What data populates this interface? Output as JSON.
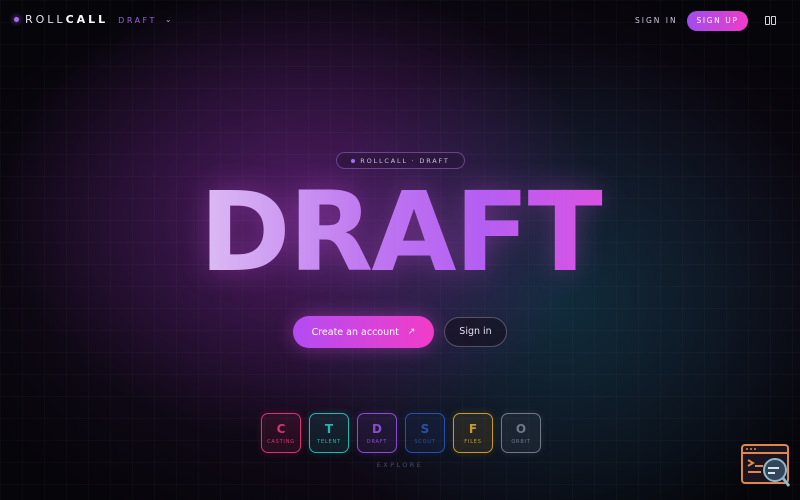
{
  "brand": {
    "roll": "ROLL",
    "call": "CALL",
    "edition": "DRAFT"
  },
  "nav": {
    "signin": "SIGN IN",
    "signup": "SIGN UP"
  },
  "badge": {
    "text": "ROLLCALL · DRAFT"
  },
  "hero": {
    "title": "DRAFT"
  },
  "cta": {
    "primary": "Create an account",
    "secondary": "Sign in"
  },
  "modules": [
    {
      "letter": "C",
      "label": "CASTING",
      "color": "#d8336e"
    },
    {
      "letter": "T",
      "label": "TELENT",
      "color": "#20b8b0"
    },
    {
      "letter": "D",
      "label": "DRAFT",
      "color": "#8a4cd0"
    },
    {
      "letter": "S",
      "label": "SCOUT",
      "color": "#2850a8"
    },
    {
      "letter": "F",
      "label": "FILES",
      "color": "#c89a2a"
    },
    {
      "letter": "O",
      "label": "ORBIT",
      "color": "#707888"
    }
  ],
  "explore": "EXPLORE",
  "colors": {
    "accent_start": "#a04cf0",
    "accent_end": "#f03cc8",
    "background": "#06050a"
  },
  "icons": {
    "menu": "chevron-down-icon",
    "layout": "panels-icon",
    "cta": "arrow-up-right-icon",
    "widget": "browser-magnifier-icon"
  }
}
